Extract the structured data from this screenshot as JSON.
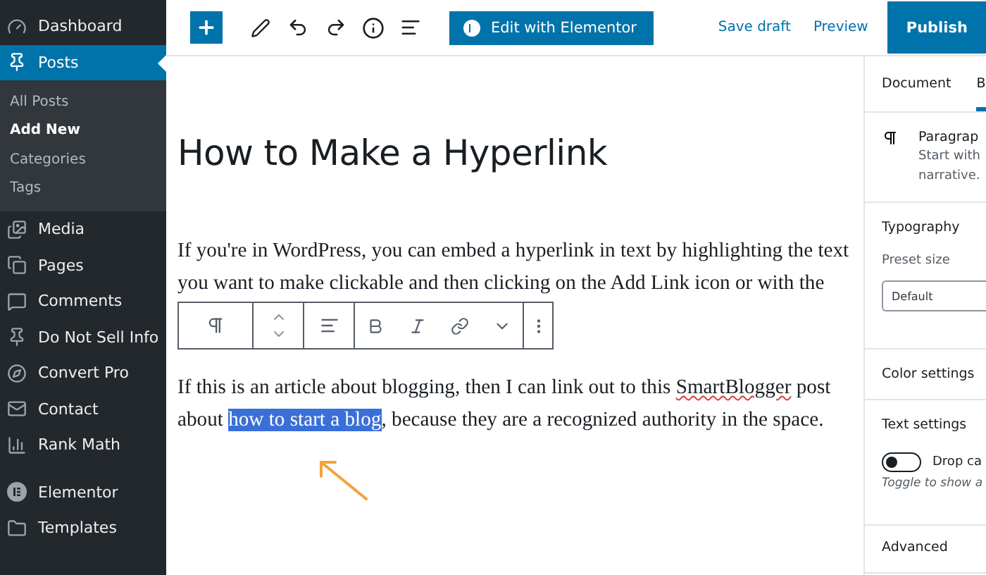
{
  "sidebar": {
    "items": [
      {
        "label": "Dashboard",
        "selected": false
      },
      {
        "label": "Posts",
        "selected": true,
        "children": [
          {
            "label": "All Posts",
            "selected": false
          },
          {
            "label": "Add New",
            "selected": true
          },
          {
            "label": "Categories",
            "selected": false
          },
          {
            "label": "Tags",
            "selected": false
          }
        ]
      },
      {
        "label": "Media",
        "selected": false
      },
      {
        "label": "Pages",
        "selected": false
      },
      {
        "label": "Comments",
        "selected": false
      },
      {
        "label": "Do Not Sell Info",
        "selected": false
      },
      {
        "label": "Convert Pro",
        "selected": false
      },
      {
        "label": "Contact",
        "selected": false
      },
      {
        "label": "Rank Math",
        "selected": false
      },
      {
        "label": "Elementor",
        "selected": false
      },
      {
        "label": "Templates",
        "selected": false
      }
    ]
  },
  "toolbar": {
    "elementor_button": "Edit with Elementor",
    "save_draft": "Save draft",
    "preview": "Preview",
    "publish": "Publish"
  },
  "editor": {
    "title": "How to Make a Hyperlink",
    "paragraphs": [
      [
        [
          {
            "kind": "text",
            "text": "If you're in WordPress, you can embed a hyperlink in text by highlighting the text"
          }
        ],
        [
          {
            "kind": "text",
            "text": "you want to make clickable and then clicking on the Add Link icon or with the"
          }
        ]
      ],
      [
        [
          {
            "kind": "text",
            "text": "If this is an article about blogging, then I can link out to this "
          },
          {
            "kind": "misspelled",
            "text": "SmartBlogger"
          },
          {
            "kind": "text",
            "text": " post"
          }
        ],
        [
          {
            "kind": "text",
            "text": "about "
          },
          {
            "kind": "selected",
            "text": "how to start a blog"
          },
          {
            "kind": "text",
            "text": ", because they are a recognized authority in the space."
          }
        ]
      ]
    ]
  },
  "settings_panel": {
    "tabs": [
      {
        "label": "Document",
        "selected": false
      },
      {
        "label": "B",
        "selected": true
      }
    ],
    "block_name": "Paragrap",
    "block_description": [
      "Start with",
      "narrative."
    ],
    "typography": "Typography",
    "preset_size_label": "Preset size",
    "preset_size_value": "Default",
    "color_settings": "Color settings",
    "text_settings": "Text settings",
    "drop_cap": {
      "label": "Drop ca",
      "on": false
    },
    "drop_cap_help": "Toggle to show a",
    "advanced": "Advanced"
  }
}
